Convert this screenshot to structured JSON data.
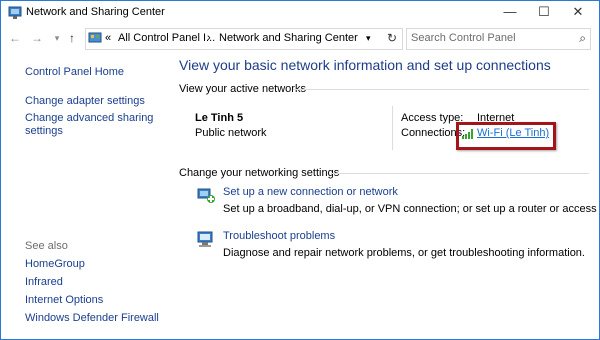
{
  "window": {
    "title": "Network and Sharing Center",
    "controls": {
      "minimize": "—",
      "maximize": "☐",
      "close": "✕"
    }
  },
  "nav": {
    "back": "←",
    "forward": "→",
    "recent": "▾",
    "up": "↑",
    "breadcrumb": {
      "overflow": "«",
      "crumb1": "All Control Panel I...",
      "separator": "›",
      "crumb2": "Network and Sharing Center",
      "dropdown": "▾"
    },
    "refresh": "↻",
    "search_placeholder": "Search Control Panel",
    "search_icon": "⌕"
  },
  "sidebar": {
    "home": "Control Panel Home",
    "adapter": "Change adapter settings",
    "sharing_line1": "Change advanced sharing",
    "sharing_line2": "settings",
    "see_also": "See also",
    "homegroup": "HomeGroup",
    "infrared": "Infrared",
    "internet_options": "Internet Options",
    "firewall": "Windows Defender Firewall"
  },
  "main": {
    "title": "View your basic network information and set up connections",
    "active_networks_heading": "View your active networks",
    "network": {
      "name": "Le Tinh  5",
      "type": "Public network",
      "access_type_label": "Access type:",
      "access_type_value": "Internet",
      "connections_label": "Connections:",
      "connection_link": "Wi-Fi (Le Tinh)"
    },
    "change_heading": "Change your networking settings",
    "options": [
      {
        "label": "Set up a new connection or network",
        "desc": "Set up a broadband, dial-up, or VPN connection; or set up a router or access point."
      },
      {
        "label": "Troubleshoot problems",
        "desc": "Diagnose and repair network problems, or get troubleshooting information."
      }
    ]
  },
  "colors": {
    "accent": "#1e3d89",
    "link": "#1a3f8f",
    "highlight_box": "#a4141b",
    "wifi_green": "#3aa32f"
  }
}
